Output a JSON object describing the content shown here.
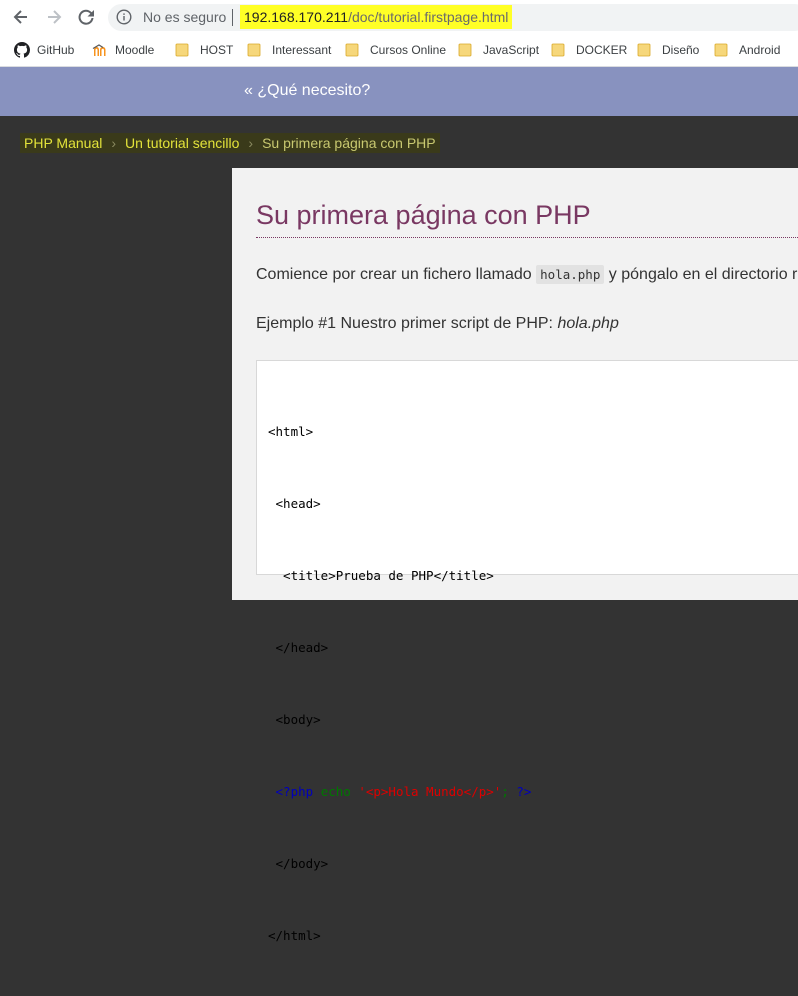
{
  "browser": {
    "security_text": "No es seguro",
    "url_host": "192.168.170.211",
    "url_path": "/doc/tutorial.firstpage.html",
    "url_highlight_color": "#ffff26"
  },
  "bookmarks": [
    {
      "label": "GitHub",
      "icon": "github-icon"
    },
    {
      "label": "Moodle",
      "icon": "moodle-icon"
    },
    {
      "label": "HOST",
      "icon": "folder-icon"
    },
    {
      "label": "Interessant",
      "icon": "folder-icon"
    },
    {
      "label": "Cursos Online",
      "icon": "folder-icon"
    },
    {
      "label": "JavaScript",
      "icon": "folder-icon"
    },
    {
      "label": "DOCKER",
      "icon": "folder-icon"
    },
    {
      "label": "Diseño",
      "icon": "folder-icon"
    },
    {
      "label": "Android",
      "icon": "folder-icon"
    }
  ],
  "page": {
    "prev_link": "« ¿Qué necesito?",
    "breadcrumbs": [
      "PHP Manual",
      "Un tutorial sencillo",
      "Su primera página con PHP"
    ],
    "breadcrumb_separator": "›",
    "title": "Su primera página con PHP",
    "intro_before": "Comience por crear un fichero llamado ",
    "intro_code": "hola.php",
    "intro_after": " y póngalo en el directorio r",
    "example_title": "Ejemplo #1 Nuestro primer script de PHP: ",
    "example_file": "hola.php",
    "code": {
      "line1": "<html>",
      "line2": " <head>",
      "line3": "  <title>Prueba de PHP</title>",
      "line4": " </head>",
      "line5": " <body>",
      "line6_open": " <?php ",
      "line6_echo": "echo ",
      "line6_str": "'<p>Hola Mundo</p>'",
      "line6_end": "; ",
      "line6_close": "?>",
      "line7": " </body>",
      "line8": "</html>"
    }
  },
  "colors": {
    "prev_bar": "#8892bf",
    "title": "#793862",
    "breadcrumb_link": "#e3e33a"
  }
}
